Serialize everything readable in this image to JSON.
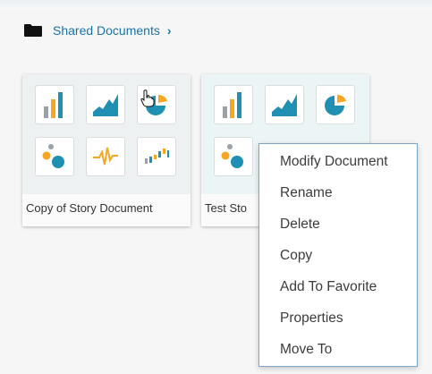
{
  "breadcrumb": {
    "folder_icon": "folder-icon",
    "label": "Shared Documents",
    "chevron": "›"
  },
  "documents": [
    {
      "label": "Copy of Story Document",
      "icons": [
        "bar-chart-icon",
        "area-chart-icon",
        "pie-chart-icon",
        "bubble-chart-icon",
        "line-pulse-icon",
        "waterfall-chart-icon"
      ]
    },
    {
      "label": "Test Sto",
      "icons": [
        "bar-chart-icon",
        "area-chart-icon",
        "pie-chart-icon",
        "bubble-chart-icon"
      ]
    }
  ],
  "context_menu": {
    "items": [
      "Modify Document",
      "Rename",
      "Delete",
      "Copy",
      "Add To Favorite",
      "Properties",
      "Move To"
    ]
  },
  "colors": {
    "link": "#1a73a8",
    "orange": "#f5a623",
    "teal": "#1f8fb3",
    "grey": "#9aa1a7",
    "menu_border": "#7fa7cc"
  }
}
